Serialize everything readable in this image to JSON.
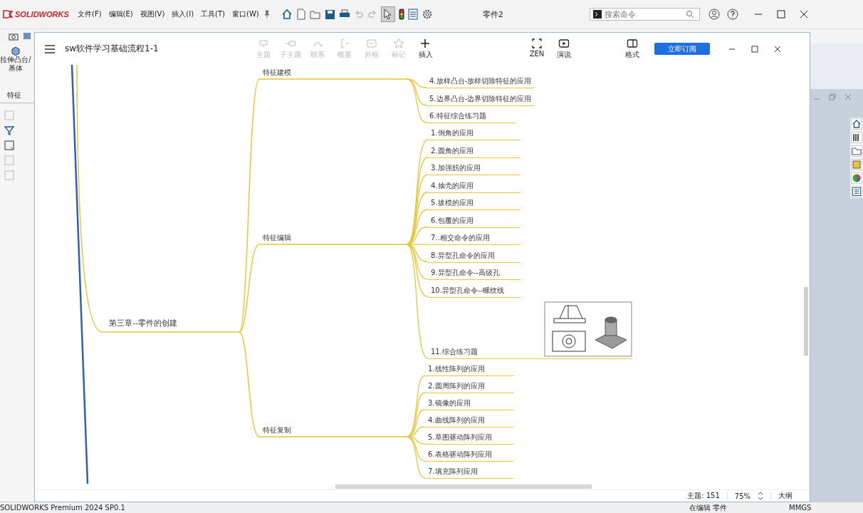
{
  "app": {
    "logo": "SOLIDWORKS",
    "menus": [
      "文件(F)",
      "编辑(E)",
      "视图(V)",
      "插入(I)",
      "工具(T)",
      "窗口(W)"
    ],
    "document_title": "零件2",
    "search": {
      "placeholder": "搜索命令"
    }
  },
  "feature_panel": {
    "command": "拉伸凸台/基体",
    "tab": "特征"
  },
  "mindmap_window": {
    "title": "sw软件学习基础流程1-1",
    "toolbar": [
      {
        "kind": "topic",
        "label": "主题",
        "disabled": true
      },
      {
        "kind": "subtopic",
        "label": "子主题",
        "disabled": true
      },
      {
        "kind": "relation",
        "label": "联系",
        "disabled": true
      },
      {
        "kind": "summary",
        "label": "概要",
        "disabled": true
      },
      {
        "kind": "boundary",
        "label": "外框",
        "disabled": true
      },
      {
        "kind": "marker",
        "label": "标记",
        "disabled": true
      },
      {
        "kind": "insert",
        "label": "插入",
        "disabled": false
      }
    ],
    "view_tools": [
      {
        "kind": "zen",
        "label": "ZEN"
      },
      {
        "kind": "pitch",
        "label": "演说"
      },
      {
        "kind": "format",
        "label": "格式"
      }
    ],
    "subscribe_button": "立即订阅",
    "map": {
      "root": "第三章--零件的创建",
      "branches": [
        {
          "label": "特征建模",
          "children": [
            {
              "kind": "text",
              "label": "4.放样凸台-放样切除特征的应用"
            },
            {
              "kind": "text",
              "label": "5.边界凸台-边界切除特征的应用"
            },
            {
              "kind": "text",
              "label": "6.特征综合练习题"
            }
          ]
        },
        {
          "label": "特征编辑",
          "children": [
            {
              "kind": "text",
              "label": "1.倒角的应用"
            },
            {
              "kind": "text",
              "label": "2.圆角的应用"
            },
            {
              "kind": "text",
              "label": "3.加强筋的应用"
            },
            {
              "kind": "text",
              "label": "4.抽壳的应用"
            },
            {
              "kind": "text",
              "label": "5.拔模的应用"
            },
            {
              "kind": "text",
              "label": "6.包覆的应用"
            },
            {
              "kind": "text",
              "label": "7..相交命令的应用"
            },
            {
              "kind": "text",
              "label": "8.异型孔命令的应用"
            },
            {
              "kind": "text",
              "label": "9.异型孔命令--高级孔"
            },
            {
              "kind": "text",
              "label": "10.异型孔命令--螺纹线"
            },
            {
              "kind": "image",
              "label": "11.综合练习题"
            }
          ]
        },
        {
          "label": "特征复制",
          "children": [
            {
              "kind": "text",
              "label": "1.线性阵列的应用"
            },
            {
              "kind": "text",
              "label": "2.圆周阵列的应用"
            },
            {
              "kind": "text",
              "label": "3.镜像的应用"
            },
            {
              "kind": "text",
              "label": "4.曲线阵列的应用"
            },
            {
              "kind": "text",
              "label": "5.草图驱动阵列应用"
            },
            {
              "kind": "text",
              "label": "6.表格驱动阵列应用"
            },
            {
              "kind": "text",
              "label": "7.填充阵列应用"
            }
          ]
        }
      ]
    },
    "status": {
      "topics": "主题: 151",
      "zoom": "75%",
      "outline": "大纲"
    }
  },
  "status_bar": {
    "product": "SOLIDWORKS Premium 2024 SP0.1",
    "mode": "在编辑 零件",
    "units": "MMGS"
  }
}
